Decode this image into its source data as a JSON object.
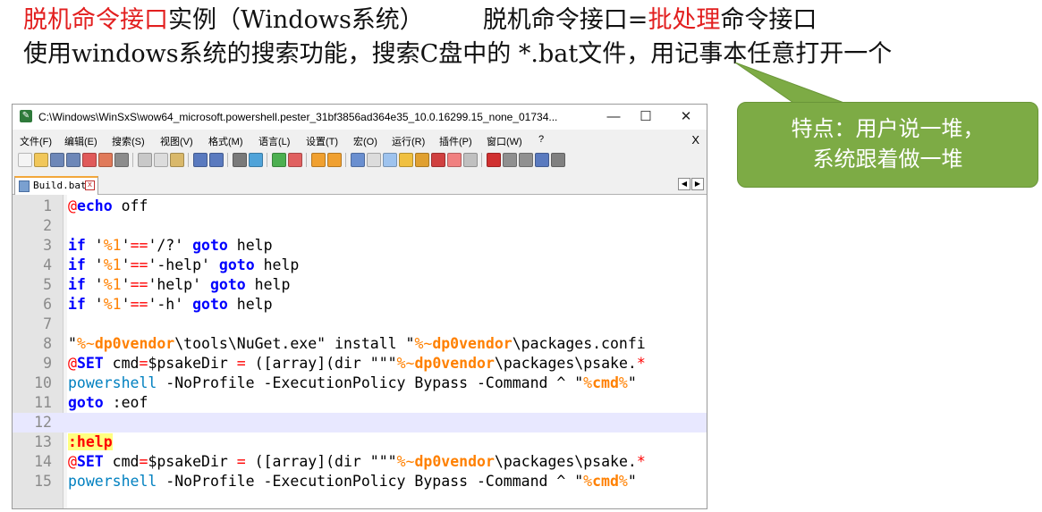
{
  "heading": {
    "line1_term1": "脱机命令接口",
    "line1_rest1": "实例（Windows系统）",
    "line1_term2": "脱机命令接口=",
    "line1_term3": "批处理",
    "line1_rest2": "命令接口",
    "line2": "使用windows系统的搜索功能，搜索C盘中的 *.bat文件，用记事本任意打开一个"
  },
  "window": {
    "title": "C:\\Windows\\WinSxS\\wow64_microsoft.powershell.pester_31bf3856ad364e35_10.0.16299.15_none_01734...",
    "minimize": "—",
    "maximize": "☐",
    "close": "✕"
  },
  "menu": [
    "文件(F)",
    "编辑(E)",
    "搜索(S)",
    "视图(V)",
    "格式(M)",
    "语言(L)",
    "设置(T)",
    "宏(O)",
    "运行(R)",
    "插件(P)",
    "窗口(W)",
    "?"
  ],
  "menu_close": "X",
  "tab": {
    "label": "Build.bat",
    "close": "x"
  },
  "tab_nav": {
    "prev": "◀",
    "next": "▶"
  },
  "code": {
    "current_line": 12,
    "lines": [
      {
        "n": "1",
        "tokens": [
          [
            "at",
            "@"
          ],
          [
            "kw",
            "echo"
          ],
          [
            "n",
            " off"
          ]
        ]
      },
      {
        "n": "2",
        "tokens": []
      },
      {
        "n": "3",
        "tokens": [
          [
            "kw",
            "if"
          ],
          [
            "n",
            " '"
          ],
          [
            "var",
            "%1"
          ],
          [
            "n",
            "'"
          ],
          [
            "op",
            "=="
          ],
          [
            "n",
            "'/?' "
          ],
          [
            "kw",
            "goto"
          ],
          [
            "n",
            " help"
          ]
        ]
      },
      {
        "n": "4",
        "tokens": [
          [
            "kw",
            "if"
          ],
          [
            "n",
            " '"
          ],
          [
            "var",
            "%1"
          ],
          [
            "n",
            "'"
          ],
          [
            "op",
            "=="
          ],
          [
            "n",
            "'-help' "
          ],
          [
            "kw",
            "goto"
          ],
          [
            "n",
            " help"
          ]
        ]
      },
      {
        "n": "5",
        "tokens": [
          [
            "kw",
            "if"
          ],
          [
            "n",
            " '"
          ],
          [
            "var",
            "%1"
          ],
          [
            "n",
            "'"
          ],
          [
            "op",
            "=="
          ],
          [
            "n",
            "'help' "
          ],
          [
            "kw",
            "goto"
          ],
          [
            "n",
            " help"
          ]
        ]
      },
      {
        "n": "6",
        "tokens": [
          [
            "kw",
            "if"
          ],
          [
            "n",
            " '"
          ],
          [
            "var",
            "%1"
          ],
          [
            "n",
            "'"
          ],
          [
            "op",
            "=="
          ],
          [
            "n",
            "'-h' "
          ],
          [
            "kw",
            "goto"
          ],
          [
            "n",
            " help"
          ]
        ]
      },
      {
        "n": "7",
        "tokens": []
      },
      {
        "n": "8",
        "tokens": [
          [
            "n",
            "\""
          ],
          [
            "var",
            "%~"
          ],
          [
            "var-b",
            "dp0vendor"
          ],
          [
            "n",
            "\\tools\\NuGet.exe\" install \""
          ],
          [
            "var",
            "%~"
          ],
          [
            "var-b",
            "dp0vendor"
          ],
          [
            "n",
            "\\packages.confi"
          ]
        ]
      },
      {
        "n": "9",
        "tokens": [
          [
            "at",
            "@"
          ],
          [
            "kw",
            "SET"
          ],
          [
            "n",
            " cmd"
          ],
          [
            "op",
            "="
          ],
          [
            "n",
            "$psakeDir "
          ],
          [
            "op",
            "="
          ],
          [
            "n",
            " ([array](dir \"\"\""
          ],
          [
            "var",
            "%~"
          ],
          [
            "var-b",
            "dp0vendor"
          ],
          [
            "n",
            "\\packages\\psake."
          ],
          [
            "op",
            "*"
          ]
        ]
      },
      {
        "n": "10",
        "tokens": [
          [
            "cmd",
            "powershell"
          ],
          [
            "n",
            " -NoProfile -ExecutionPolicy Bypass -Command ^ \""
          ],
          [
            "var",
            "%"
          ],
          [
            "var-b",
            "cmd"
          ],
          [
            "var",
            "%"
          ],
          [
            "n",
            "\""
          ]
        ]
      },
      {
        "n": "11",
        "tokens": [
          [
            "kw",
            "goto"
          ],
          [
            "n",
            " :eof"
          ]
        ]
      },
      {
        "n": "12",
        "tokens": []
      },
      {
        "n": "13",
        "tokens": [
          [
            "lbl",
            ":help"
          ]
        ]
      },
      {
        "n": "14",
        "tokens": [
          [
            "at",
            "@"
          ],
          [
            "kw",
            "SET"
          ],
          [
            "n",
            " cmd"
          ],
          [
            "op",
            "="
          ],
          [
            "n",
            "$psakeDir "
          ],
          [
            "op",
            "="
          ],
          [
            "n",
            " ([array](dir \"\"\""
          ],
          [
            "var",
            "%~"
          ],
          [
            "var-b",
            "dp0vendor"
          ],
          [
            "n",
            "\\packages\\psake."
          ],
          [
            "op",
            "*"
          ]
        ]
      },
      {
        "n": "15",
        "tokens": [
          [
            "cmd",
            "powershell"
          ],
          [
            "n",
            " -NoProfile -ExecutionPolicy Bypass -Command ^ \""
          ],
          [
            "var",
            "%"
          ],
          [
            "var-b",
            "cmd"
          ],
          [
            "var",
            "%"
          ],
          [
            "n",
            "\""
          ]
        ]
      }
    ]
  },
  "callout": {
    "line1": "特点：用户说一堆，",
    "line2": "系统跟着做一堆",
    "color": "#7dab45"
  },
  "colors": {
    "highlight_red": "#e21f1f",
    "keyword_blue": "#0000ff",
    "variable_orange": "#ff8000",
    "command_blue": "#0080c0"
  }
}
